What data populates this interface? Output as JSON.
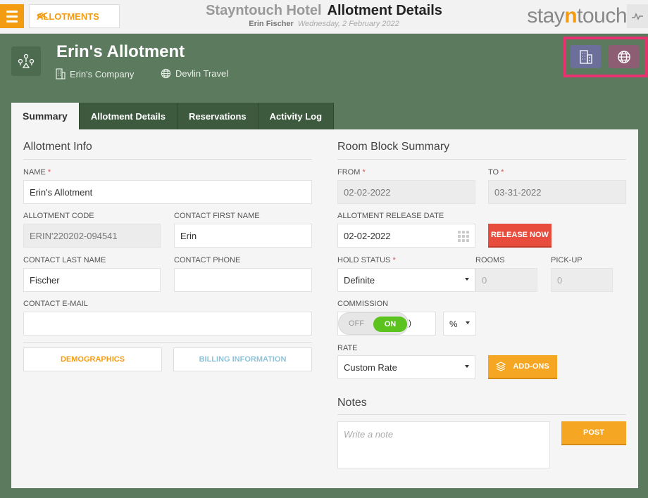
{
  "topbar": {
    "back_label": "ALLOTMENTS",
    "hotel_name": "Stayntouch Hotel",
    "page_title": "Allotment Details",
    "user_name": "Erin Fischer",
    "date": "Wednesday, 2 February 2022",
    "brand_prefix": "stay",
    "brand_n": "n",
    "brand_suffix": "touch"
  },
  "header": {
    "title": "Erin's Allotment",
    "company": "Erin's Company",
    "travel_agent": "Devlin Travel"
  },
  "tabs": [
    {
      "label": "Summary",
      "active": true
    },
    {
      "label": "Allotment Details"
    },
    {
      "label": "Reservations"
    },
    {
      "label": "Activity Log"
    }
  ],
  "allotment_info": {
    "title": "Allotment Info",
    "name_label": "NAME",
    "name_value": "Erin's Allotment",
    "code_label": "ALLOTMENT CODE",
    "code_value": "ERIN'220202-094541",
    "contact_first_label": "CONTACT FIRST NAME",
    "contact_first_value": "Erin",
    "contact_last_label": "CONTACT LAST NAME",
    "contact_last_value": "Fischer",
    "contact_phone_label": "CONTACT PHONE",
    "contact_phone_value": "",
    "contact_email_label": "CONTACT E-MAIL",
    "contact_email_value": "",
    "demographics_label": "DEMOGRAPHICS",
    "billing_label": "BILLING INFORMATION"
  },
  "room_block": {
    "title": "Room Block Summary",
    "from_label": "FROM",
    "from_value": "02-02-2022",
    "to_label": "TO",
    "to_value": "03-31-2022",
    "release_date_label": "ALLOTMENT RELEASE DATE",
    "release_date_value": "02-02-2022",
    "release_now_label": "RELEASE NOW",
    "hold_status_label": "HOLD STATUS",
    "hold_status_value": "Definite",
    "rooms_label": "ROOMS",
    "rooms_value": "0",
    "pickup_label": "PICK-UP",
    "pickup_value": "0",
    "commission_label": "COMMISSION",
    "commission_off": "OFF",
    "commission_on": "ON",
    "commission_tail": ")",
    "commission_unit": "%",
    "rate_label": "RATE",
    "rate_value": "Custom Rate",
    "addons_label": "ADD-ONS"
  },
  "notes": {
    "title": "Notes",
    "placeholder": "Write a note",
    "post_label": "POST"
  },
  "colors": {
    "accent": "#f39c12",
    "background": "#5c7a5e",
    "tab_bg": "#3d5a3f",
    "release_red": "#e74c3c",
    "toggle_green": "#5cc21e",
    "highlight_pink": "#e8316e"
  }
}
